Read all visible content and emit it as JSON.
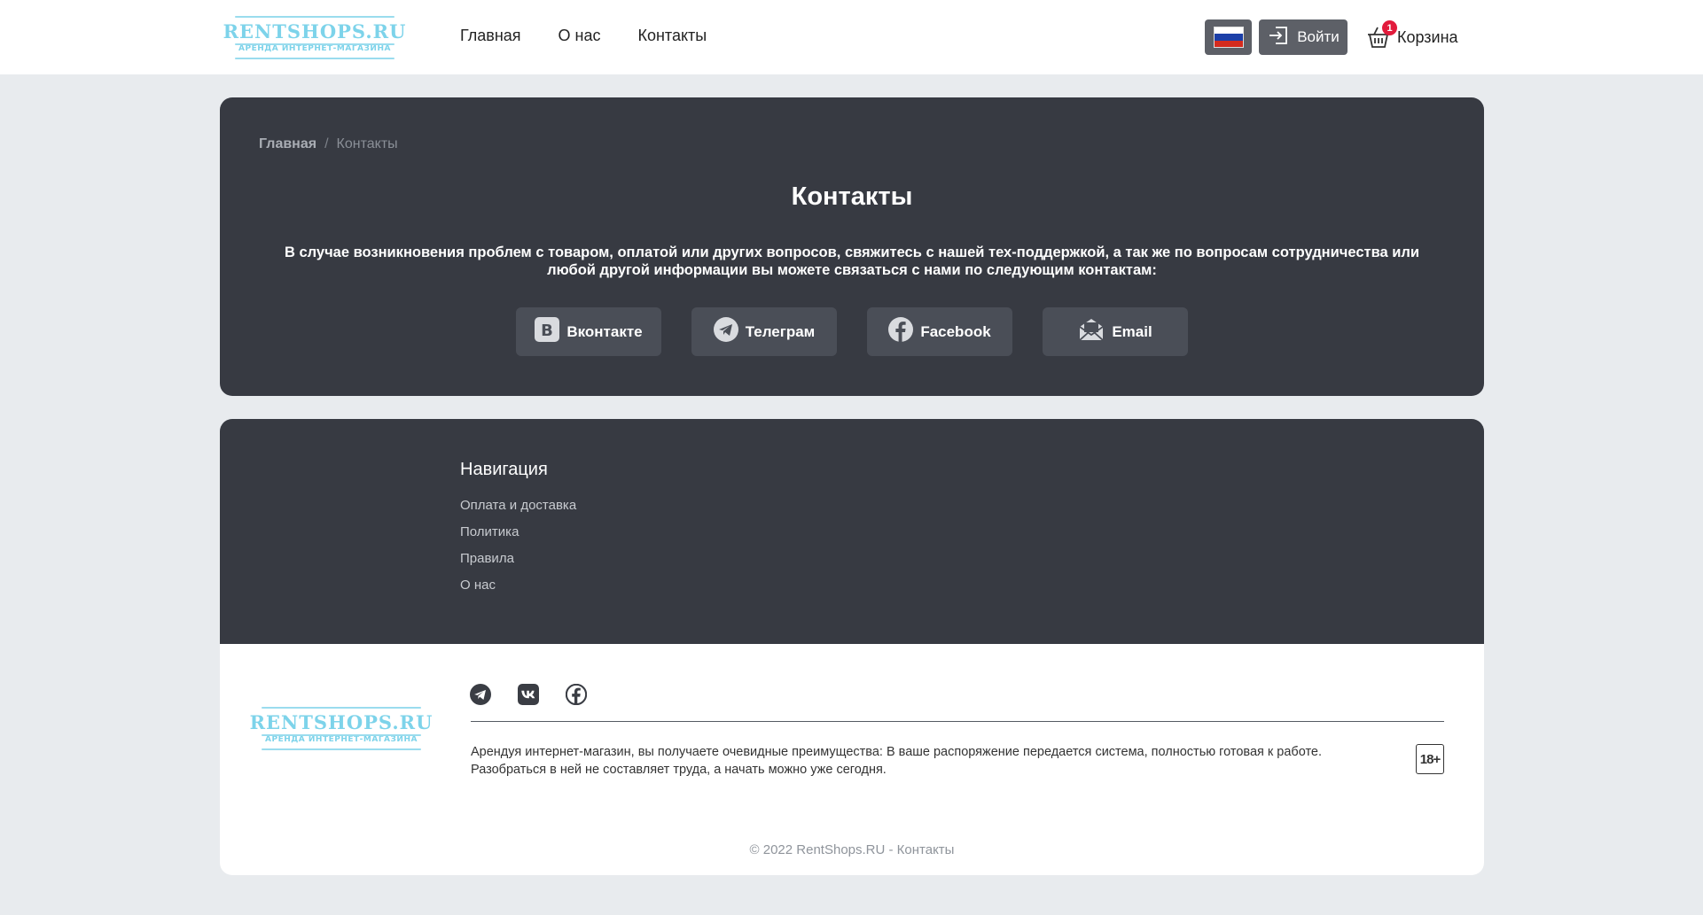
{
  "header": {
    "logo": {
      "brand": "RENTSHOPS.RU",
      "tagline": "АРЕНДА ИНТЕРНЕТ-МАГАЗИНА"
    },
    "nav": [
      {
        "label": "Главная"
      },
      {
        "label": "О нас"
      },
      {
        "label": "Контакты"
      }
    ],
    "language": {
      "icon": "russia-flag-icon"
    },
    "login": {
      "label": "Войти",
      "icon": "login-icon"
    },
    "cart": {
      "label": "Корзина",
      "count": "1",
      "icon": "basket-icon"
    }
  },
  "breadcrumb": {
    "home": "Главная",
    "separator": "/",
    "current": "Контакты"
  },
  "contacts": {
    "title": "Контакты",
    "description": "В случае возникновения проблем с товаром, оплатой или других вопросов, свяжитесь с нашей тех-поддержкой, а так же по вопросам сотрудничества или любой другой информации вы можете связаться с нами по следующим контактам:",
    "buttons": [
      {
        "label": "Вконтакте",
        "icon": "vk-icon"
      },
      {
        "label": "Телеграм",
        "icon": "telegram-icon"
      },
      {
        "label": "Facebook",
        "icon": "facebook-icon"
      },
      {
        "label": "Email",
        "icon": "email-icon"
      }
    ]
  },
  "footer": {
    "nav_title": "Навигация",
    "links": [
      {
        "label": "Оплата и доставка"
      },
      {
        "label": "Политика"
      },
      {
        "label": "Правила"
      },
      {
        "label": "О нас"
      }
    ],
    "logo": {
      "brand": "RENTSHOPS.RU",
      "tagline": "АРЕНДА ИНТЕРНЕТ-МАГАЗИНА"
    },
    "social_icons": [
      "telegram-icon",
      "vk-icon",
      "facebook-icon"
    ],
    "description": "Арендуя интернет-магазин, вы получаете очевидные преимущества: В ваше распоряжение передается система, полностью готовая к работе. Разобраться в ней не составляет труда, а начать можно уже сегодня.",
    "age_badge": "18+",
    "copyright": "© 2022 RentShops.RU - Контакты"
  },
  "colors": {
    "page_bg": "#e8ebee",
    "card_bg": "#373a42",
    "button_bg": "#4a4e57",
    "header_btn_bg": "#5d6067",
    "logo_color": "#7dd3ea",
    "badge_red": "#e21b3c"
  }
}
